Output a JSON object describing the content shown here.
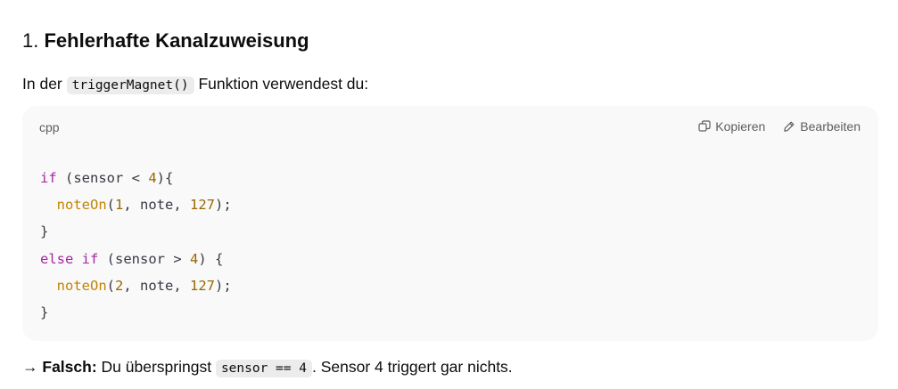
{
  "heading": {
    "number": "1.",
    "title": "Fehlerhafte Kanalzuweisung"
  },
  "intro": {
    "before": "In der",
    "code": "triggerMagnet()",
    "after": "Funktion verwendest du:"
  },
  "code_block": {
    "language": "cpp",
    "copy_label": "Kopieren",
    "edit_label": "Bearbeiten",
    "copy_icon": "copy-icon",
    "edit_icon": "pencil-icon",
    "lines": [
      [
        {
          "t": "if",
          "c": "kw"
        },
        {
          "t": " (sensor < ",
          "c": ""
        },
        {
          "t": "4",
          "c": "num"
        },
        {
          "t": "){",
          "c": ""
        }
      ],
      [
        {
          "t": "  ",
          "c": ""
        },
        {
          "t": "noteOn",
          "c": "fn"
        },
        {
          "t": "(",
          "c": ""
        },
        {
          "t": "1",
          "c": "num"
        },
        {
          "t": ", note, ",
          "c": ""
        },
        {
          "t": "127",
          "c": "num"
        },
        {
          "t": ");",
          "c": ""
        }
      ],
      [
        {
          "t": "}",
          "c": ""
        }
      ],
      [
        {
          "t": "else",
          "c": "kw"
        },
        {
          "t": " ",
          "c": ""
        },
        {
          "t": "if",
          "c": "kw"
        },
        {
          "t": " (sensor > ",
          "c": ""
        },
        {
          "t": "4",
          "c": "num"
        },
        {
          "t": ") {",
          "c": ""
        }
      ],
      [
        {
          "t": "  ",
          "c": ""
        },
        {
          "t": "noteOn",
          "c": "fn"
        },
        {
          "t": "(",
          "c": ""
        },
        {
          "t": "2",
          "c": "num"
        },
        {
          "t": ", note, ",
          "c": ""
        },
        {
          "t": "127",
          "c": "num"
        },
        {
          "t": ");",
          "c": ""
        }
      ],
      [
        {
          "t": "}",
          "c": ""
        }
      ]
    ],
    "colors": {
      "keyword": "#a626a4",
      "function": "#c18401",
      "number": "#986801",
      "text": "#383a42",
      "background": "#f9f9f9"
    }
  },
  "conclusion": {
    "arrow": "→",
    "label": "Falsch:",
    "before": "Du überspringst",
    "code": "sensor == 4",
    "after": ". Sensor 4 triggert gar nichts."
  }
}
